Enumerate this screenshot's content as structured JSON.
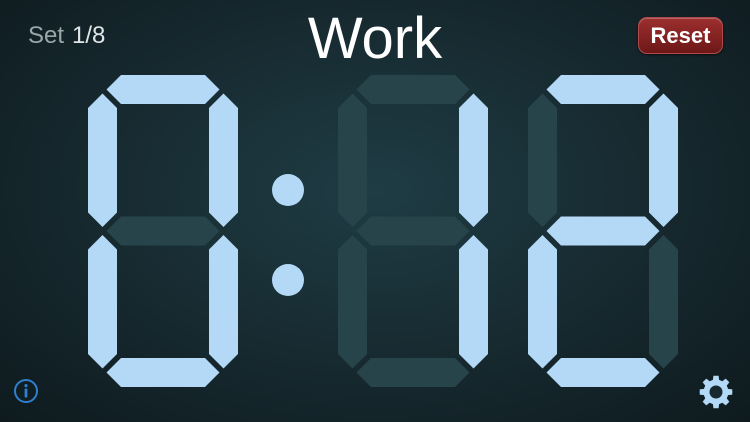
{
  "header": {
    "set_word": "Set",
    "set_value": "1/8",
    "mode": "Work",
    "reset_label": "Reset"
  },
  "timer": {
    "digits": [
      "0",
      "1",
      "2"
    ],
    "separator": ":"
  },
  "icons": {
    "info": "info-icon",
    "settings": "gear-icon"
  },
  "colors": {
    "segment_on": "#b3d9f7",
    "segment_off": "#264449",
    "reset_button": "#8b2222",
    "info_icon": "#2f7fd0"
  }
}
